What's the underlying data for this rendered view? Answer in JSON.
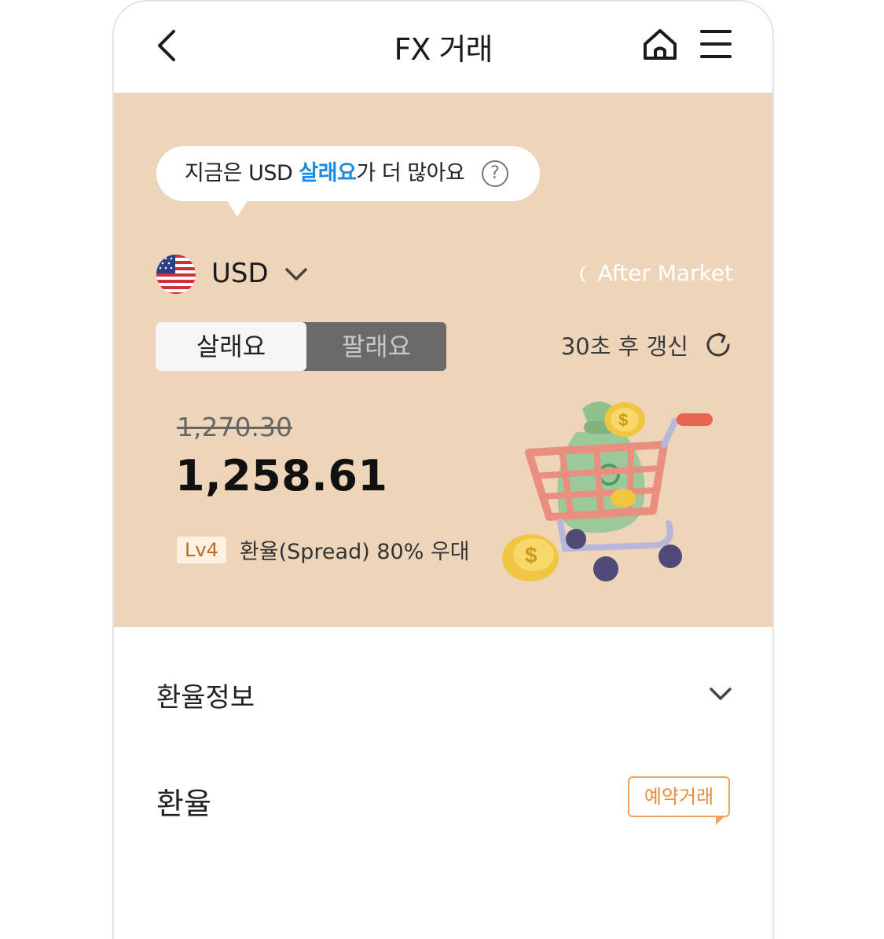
{
  "header": {
    "title": "FX 거래",
    "back_icon": "chevron-left-icon",
    "home_icon": "home-icon",
    "menu_icon": "hamburger-menu-icon"
  },
  "hero": {
    "background_color": "#eed5b9",
    "bubble": {
      "prefix": "지금은 USD ",
      "highlight": "살래요",
      "suffix": "가 더 많아요",
      "highlight_color": "#1a8be0",
      "help_icon": "?"
    },
    "currency": {
      "code": "USD",
      "flag_icon": "us-flag-icon"
    },
    "market_status": "After Market",
    "toggle": {
      "buy": "살래요",
      "sell": "팔래요",
      "selected": "buy"
    },
    "refresh_text": "30초 후 갱신",
    "rate": {
      "original": "1,270.30",
      "discounted": "1,258.61"
    },
    "level": {
      "badge": "Lv4",
      "text": "환율(Spread) 80% 우대"
    }
  },
  "sections": {
    "rate_info_title": "환율정보",
    "rate_title": "환율",
    "reserve_button": "예약거래"
  }
}
